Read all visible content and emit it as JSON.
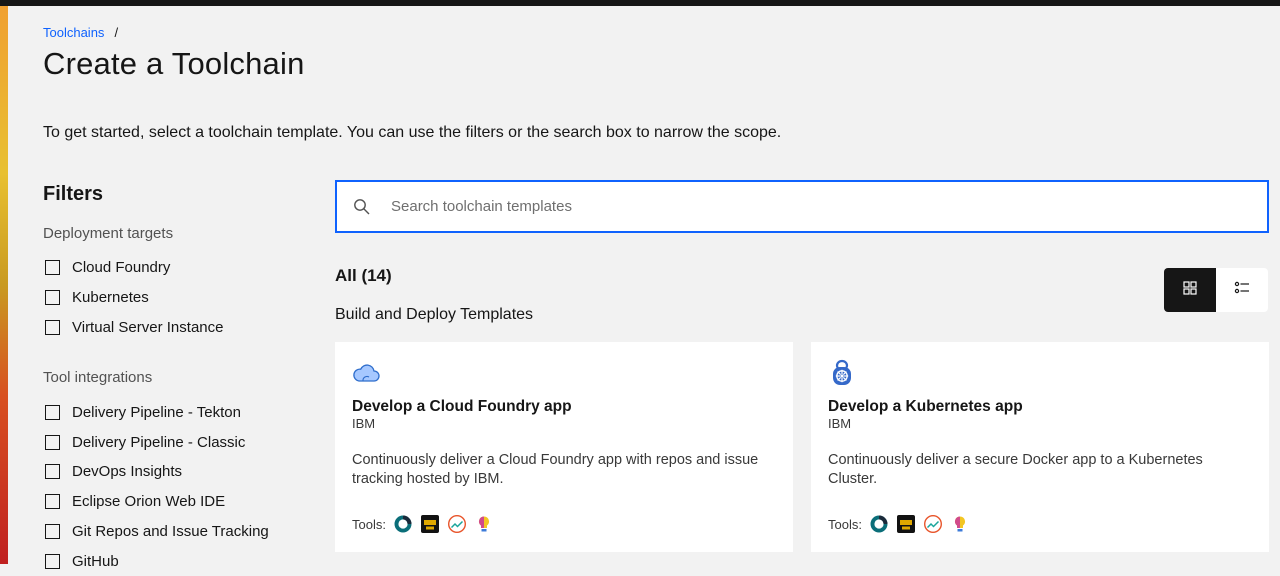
{
  "breadcrumb": {
    "root": "Toolchains",
    "separator": "/"
  },
  "page": {
    "title": "Create a Toolchain",
    "intro": "To get started, select a toolchain template. You can use the filters or the search box to narrow the scope."
  },
  "filters": {
    "heading": "Filters",
    "deployment_targets": {
      "title": "Deployment targets",
      "items": [
        "Cloud Foundry",
        "Kubernetes",
        "Virtual Server Instance"
      ]
    },
    "tool_integrations": {
      "title": "Tool integrations",
      "items": [
        "Delivery Pipeline - Tekton",
        "Delivery Pipeline - Classic",
        "DevOps Insights",
        "Eclipse Orion Web IDE",
        "Git Repos and Issue Tracking",
        "GitHub"
      ]
    }
  },
  "search": {
    "placeholder": "Search toolchain templates",
    "icon": "search-icon"
  },
  "results": {
    "all_label": "All (14)",
    "section_title": "Build and Deploy Templates"
  },
  "view_toggle": {
    "active": "grid-view",
    "icons": [
      "grid-view-icon",
      "list-view-icon"
    ]
  },
  "cards": [
    {
      "icon": "cloud-foundry-icon",
      "title": "Develop a Cloud Foundry app",
      "provider": "IBM",
      "description": "Continuously deliver a Cloud Foundry app with repos and issue tracking hosted by IBM.",
      "tools_label": "Tools:",
      "tools": [
        "git-repos-icon",
        "orion-ide-icon",
        "delivery-pipeline-icon",
        "devops-insights-icon"
      ]
    },
    {
      "icon": "kubernetes-icon",
      "title": "Develop a Kubernetes app",
      "provider": "IBM",
      "description": "Continuously deliver a secure Docker app to a Kubernetes Cluster.",
      "tools_label": "Tools:",
      "tools": [
        "git-repos-icon",
        "orion-ide-icon",
        "delivery-pipeline-icon",
        "devops-insights-icon"
      ]
    }
  ],
  "colors": {
    "accent": "#0f62fe",
    "background": "#f2f2f2",
    "dark": "#161616"
  }
}
